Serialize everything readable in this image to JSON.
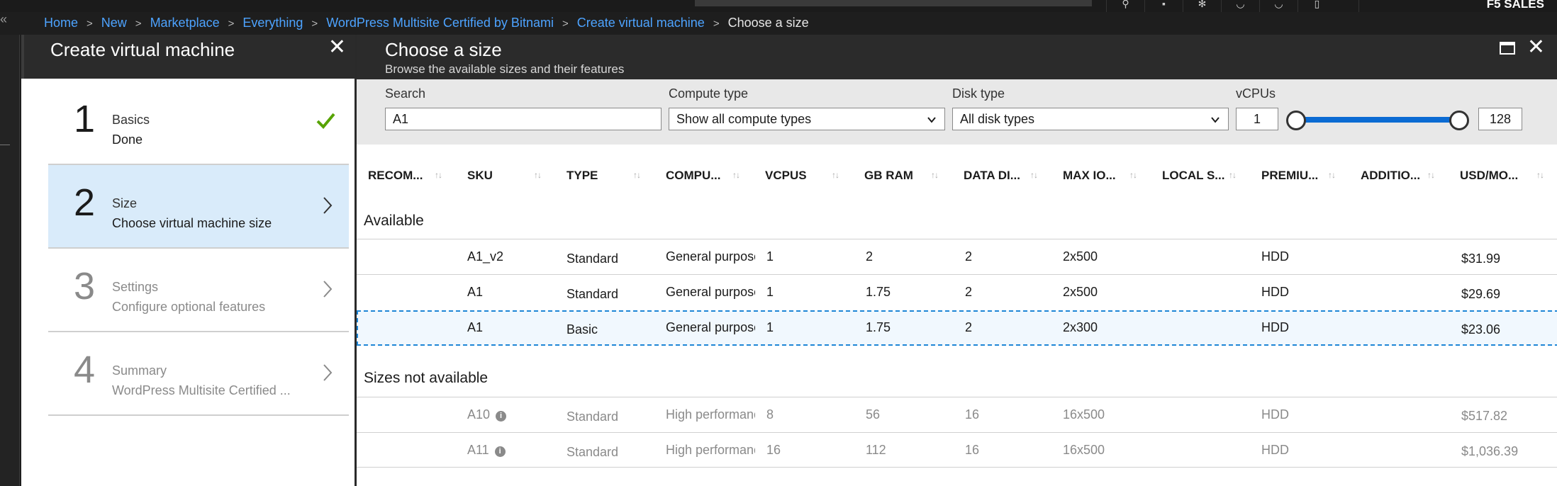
{
  "topbar": {
    "account": "F5 SALES"
  },
  "breadcrumb": {
    "items": [
      "Home",
      "New",
      "Marketplace",
      "Everything",
      "WordPress Multisite Certified by Bitnami",
      "Create virtual machine"
    ],
    "current": "Choose a size"
  },
  "create_blade": {
    "title": "Create virtual machine",
    "steps": [
      {
        "number": "1",
        "label": "Basics",
        "sub": "Done",
        "state": "done"
      },
      {
        "number": "2",
        "label": "Size",
        "sub": "Choose virtual machine size",
        "state": "active"
      },
      {
        "number": "3",
        "label": "Settings",
        "sub": "Configure optional features",
        "state": "pending"
      },
      {
        "number": "4",
        "label": "Summary",
        "sub": "WordPress Multisite Certified ...",
        "state": "pending"
      }
    ]
  },
  "size_blade": {
    "title": "Choose a size",
    "subtitle": "Browse the available sizes and their features",
    "filters": {
      "search_label": "Search",
      "search_value": "A1",
      "compute_label": "Compute type",
      "compute_value": "Show all compute types",
      "disk_label": "Disk type",
      "disk_value": "All disk types",
      "vcpu_label": "vCPUs",
      "vcpu_min": "1",
      "vcpu_max": "128"
    },
    "columns": [
      "RECOM...",
      "SKU",
      "TYPE",
      "COMPU...",
      "VCPUS",
      "GB RAM",
      "DATA DI...",
      "MAX IO...",
      "LOCAL S...",
      "PREMIU...",
      "ADDITIO...",
      "USD/MO..."
    ],
    "available_title": "Available",
    "available": [
      {
        "sku": "A1_v2",
        "type": "Standard",
        "compute": "General purpose",
        "vcpus": "1",
        "ram": "2",
        "disks": "2",
        "iops": "2x500",
        "premium": "HDD",
        "price": "$31.99"
      },
      {
        "sku": "A1",
        "type": "Standard",
        "compute": "General purpose",
        "vcpus": "1",
        "ram": "1.75",
        "disks": "2",
        "iops": "2x500",
        "premium": "HDD",
        "price": "$29.69"
      },
      {
        "sku": "A1",
        "type": "Basic",
        "compute": "General purpose",
        "vcpus": "1",
        "ram": "1.75",
        "disks": "2",
        "iops": "2x300",
        "premium": "HDD",
        "price": "$23.06"
      }
    ],
    "unavailable_title": "Sizes not available",
    "unavailable": [
      {
        "sku": "A10",
        "type": "Standard",
        "compute": "High performance",
        "vcpus": "8",
        "ram": "56",
        "disks": "16",
        "iops": "16x500",
        "premium": "HDD",
        "price": "$517.82"
      },
      {
        "sku": "A11",
        "type": "Standard",
        "compute": "High performance",
        "vcpus": "16",
        "ram": "112",
        "disks": "16",
        "iops": "16x500",
        "premium": "HDD",
        "price": "$1,036.39"
      }
    ]
  }
}
